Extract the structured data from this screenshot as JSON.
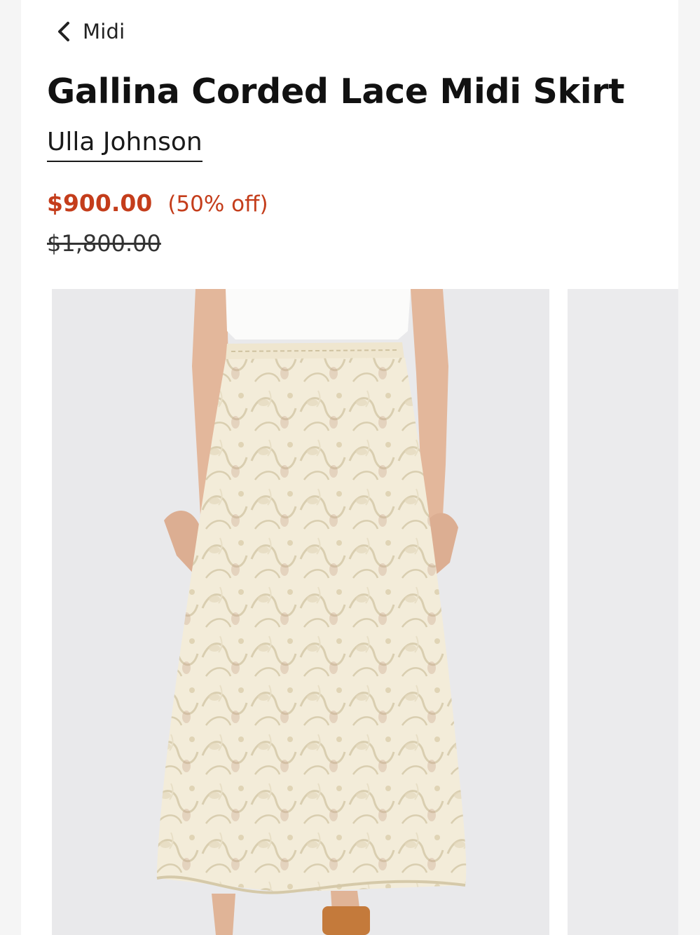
{
  "nav": {
    "back_label": "Midi",
    "back_icon": "chevron-left-icon"
  },
  "product": {
    "title": "Gallina Corded Lace Midi Skirt",
    "brand": "Ulla Johnson",
    "sale_price": "$900.00",
    "discount": "(50% off)",
    "original_price": "$1,800.00"
  },
  "colors": {
    "sale": "#c43d1b",
    "text": "#111111",
    "lace": "#f1ead7",
    "photo_background": "#e9e9eb"
  },
  "gallery": {
    "visible_images": 2
  }
}
